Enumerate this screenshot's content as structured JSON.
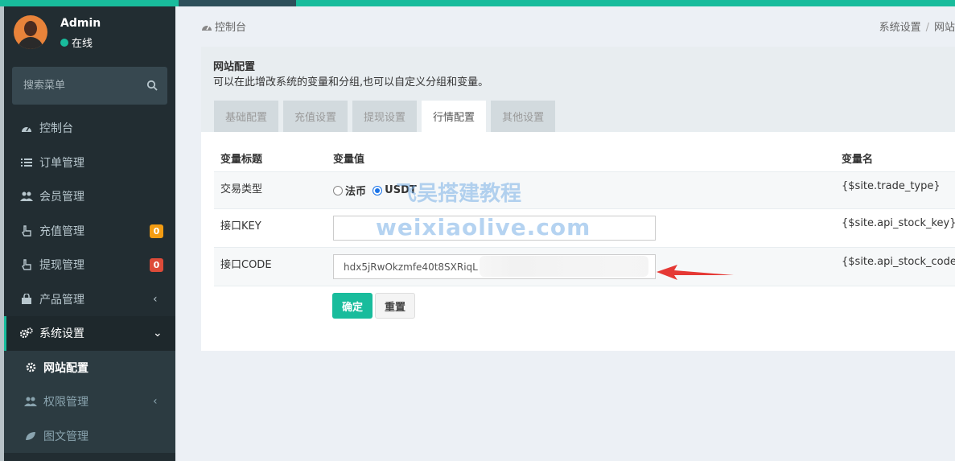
{
  "sidebar": {
    "user": {
      "name": "Admin",
      "status": "在线"
    },
    "search": {
      "placeholder": "搜索菜单"
    },
    "items": [
      {
        "label": "控制台",
        "icon": "dashboard-icon"
      },
      {
        "label": "订单管理",
        "icon": "list-icon"
      },
      {
        "label": "会员管理",
        "icon": "users-icon"
      },
      {
        "label": "充值管理",
        "icon": "hand-icon",
        "badge": "0",
        "badge_color": "#f39c12"
      },
      {
        "label": "提现管理",
        "icon": "hand-icon",
        "badge": "0",
        "badge_color": "#dd4b39"
      },
      {
        "label": "产品管理",
        "icon": "shopping-bag-icon"
      },
      {
        "label": "系统设置",
        "icon": "cogs-icon"
      },
      {
        "label": "网站配置",
        "icon": "gear-icon"
      },
      {
        "label": "权限管理",
        "icon": "users-icon"
      },
      {
        "label": "图文管理",
        "icon": "leaf-icon"
      }
    ]
  },
  "breadcrumb": {
    "left": "控制台",
    "right": [
      "系统设置",
      "网站"
    ]
  },
  "panel": {
    "title": "网站配置",
    "description": "可以在此增改系统的变量和分组,也可以自定义分组和变量。",
    "tabs": [
      "基础配置",
      "充值设置",
      "提现设置",
      "行情配置",
      "其他设置"
    ],
    "active_tab": "行情配置"
  },
  "table": {
    "headers": [
      "变量标题",
      "变量值",
      "变量名"
    ],
    "rows": [
      {
        "title": "交易类型",
        "radio_options": [
          "法币",
          "USDT"
        ],
        "selected": "USDT",
        "var": "{$site.trade_type}"
      },
      {
        "title": "接口KEY",
        "value": "",
        "var": "{$site.api_stock_key}"
      },
      {
        "title": "接口CODE",
        "value": "hdx5jRwOkzmfe40t8SXRiqL",
        "var": "{$site.api_stock_code}"
      }
    ]
  },
  "buttons": {
    "submit": "确定",
    "reset": "重置"
  },
  "watermark": {
    "line1": "飞吴搭建教程",
    "line2": "weixiaolive.com"
  },
  "colors": {
    "accent": "#18bc9c",
    "sidebar_bg": "#222d32",
    "arrow": "#e53935"
  }
}
